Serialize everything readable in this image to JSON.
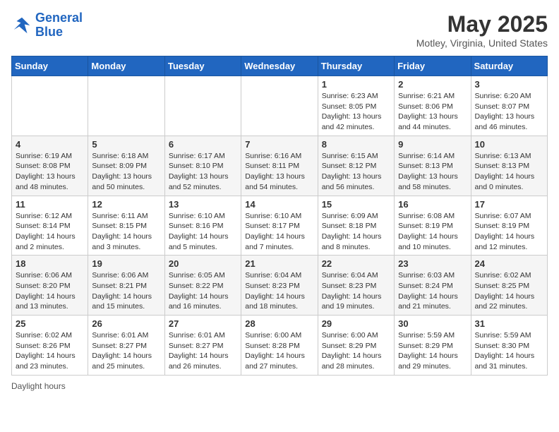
{
  "header": {
    "logo_line1": "General",
    "logo_line2": "Blue",
    "title": "May 2025",
    "subtitle": "Motley, Virginia, United States"
  },
  "days_of_week": [
    "Sunday",
    "Monday",
    "Tuesday",
    "Wednesday",
    "Thursday",
    "Friday",
    "Saturday"
  ],
  "weeks": [
    [
      {
        "day": "",
        "info": ""
      },
      {
        "day": "",
        "info": ""
      },
      {
        "day": "",
        "info": ""
      },
      {
        "day": "",
        "info": ""
      },
      {
        "day": "1",
        "info": "Sunrise: 6:23 AM\nSunset: 8:05 PM\nDaylight: 13 hours and 42 minutes."
      },
      {
        "day": "2",
        "info": "Sunrise: 6:21 AM\nSunset: 8:06 PM\nDaylight: 13 hours and 44 minutes."
      },
      {
        "day": "3",
        "info": "Sunrise: 6:20 AM\nSunset: 8:07 PM\nDaylight: 13 hours and 46 minutes."
      }
    ],
    [
      {
        "day": "4",
        "info": "Sunrise: 6:19 AM\nSunset: 8:08 PM\nDaylight: 13 hours and 48 minutes."
      },
      {
        "day": "5",
        "info": "Sunrise: 6:18 AM\nSunset: 8:09 PM\nDaylight: 13 hours and 50 minutes."
      },
      {
        "day": "6",
        "info": "Sunrise: 6:17 AM\nSunset: 8:10 PM\nDaylight: 13 hours and 52 minutes."
      },
      {
        "day": "7",
        "info": "Sunrise: 6:16 AM\nSunset: 8:11 PM\nDaylight: 13 hours and 54 minutes."
      },
      {
        "day": "8",
        "info": "Sunrise: 6:15 AM\nSunset: 8:12 PM\nDaylight: 13 hours and 56 minutes."
      },
      {
        "day": "9",
        "info": "Sunrise: 6:14 AM\nSunset: 8:13 PM\nDaylight: 13 hours and 58 minutes."
      },
      {
        "day": "10",
        "info": "Sunrise: 6:13 AM\nSunset: 8:13 PM\nDaylight: 14 hours and 0 minutes."
      }
    ],
    [
      {
        "day": "11",
        "info": "Sunrise: 6:12 AM\nSunset: 8:14 PM\nDaylight: 14 hours and 2 minutes."
      },
      {
        "day": "12",
        "info": "Sunrise: 6:11 AM\nSunset: 8:15 PM\nDaylight: 14 hours and 3 minutes."
      },
      {
        "day": "13",
        "info": "Sunrise: 6:10 AM\nSunset: 8:16 PM\nDaylight: 14 hours and 5 minutes."
      },
      {
        "day": "14",
        "info": "Sunrise: 6:10 AM\nSunset: 8:17 PM\nDaylight: 14 hours and 7 minutes."
      },
      {
        "day": "15",
        "info": "Sunrise: 6:09 AM\nSunset: 8:18 PM\nDaylight: 14 hours and 8 minutes."
      },
      {
        "day": "16",
        "info": "Sunrise: 6:08 AM\nSunset: 8:19 PM\nDaylight: 14 hours and 10 minutes."
      },
      {
        "day": "17",
        "info": "Sunrise: 6:07 AM\nSunset: 8:19 PM\nDaylight: 14 hours and 12 minutes."
      }
    ],
    [
      {
        "day": "18",
        "info": "Sunrise: 6:06 AM\nSunset: 8:20 PM\nDaylight: 14 hours and 13 minutes."
      },
      {
        "day": "19",
        "info": "Sunrise: 6:06 AM\nSunset: 8:21 PM\nDaylight: 14 hours and 15 minutes."
      },
      {
        "day": "20",
        "info": "Sunrise: 6:05 AM\nSunset: 8:22 PM\nDaylight: 14 hours and 16 minutes."
      },
      {
        "day": "21",
        "info": "Sunrise: 6:04 AM\nSunset: 8:23 PM\nDaylight: 14 hours and 18 minutes."
      },
      {
        "day": "22",
        "info": "Sunrise: 6:04 AM\nSunset: 8:23 PM\nDaylight: 14 hours and 19 minutes."
      },
      {
        "day": "23",
        "info": "Sunrise: 6:03 AM\nSunset: 8:24 PM\nDaylight: 14 hours and 21 minutes."
      },
      {
        "day": "24",
        "info": "Sunrise: 6:02 AM\nSunset: 8:25 PM\nDaylight: 14 hours and 22 minutes."
      }
    ],
    [
      {
        "day": "25",
        "info": "Sunrise: 6:02 AM\nSunset: 8:26 PM\nDaylight: 14 hours and 23 minutes."
      },
      {
        "day": "26",
        "info": "Sunrise: 6:01 AM\nSunset: 8:27 PM\nDaylight: 14 hours and 25 minutes."
      },
      {
        "day": "27",
        "info": "Sunrise: 6:01 AM\nSunset: 8:27 PM\nDaylight: 14 hours and 26 minutes."
      },
      {
        "day": "28",
        "info": "Sunrise: 6:00 AM\nSunset: 8:28 PM\nDaylight: 14 hours and 27 minutes."
      },
      {
        "day": "29",
        "info": "Sunrise: 6:00 AM\nSunset: 8:29 PM\nDaylight: 14 hours and 28 minutes."
      },
      {
        "day": "30",
        "info": "Sunrise: 5:59 AM\nSunset: 8:29 PM\nDaylight: 14 hours and 29 minutes."
      },
      {
        "day": "31",
        "info": "Sunrise: 5:59 AM\nSunset: 8:30 PM\nDaylight: 14 hours and 31 minutes."
      }
    ]
  ],
  "footer": {
    "note": "Daylight hours"
  }
}
